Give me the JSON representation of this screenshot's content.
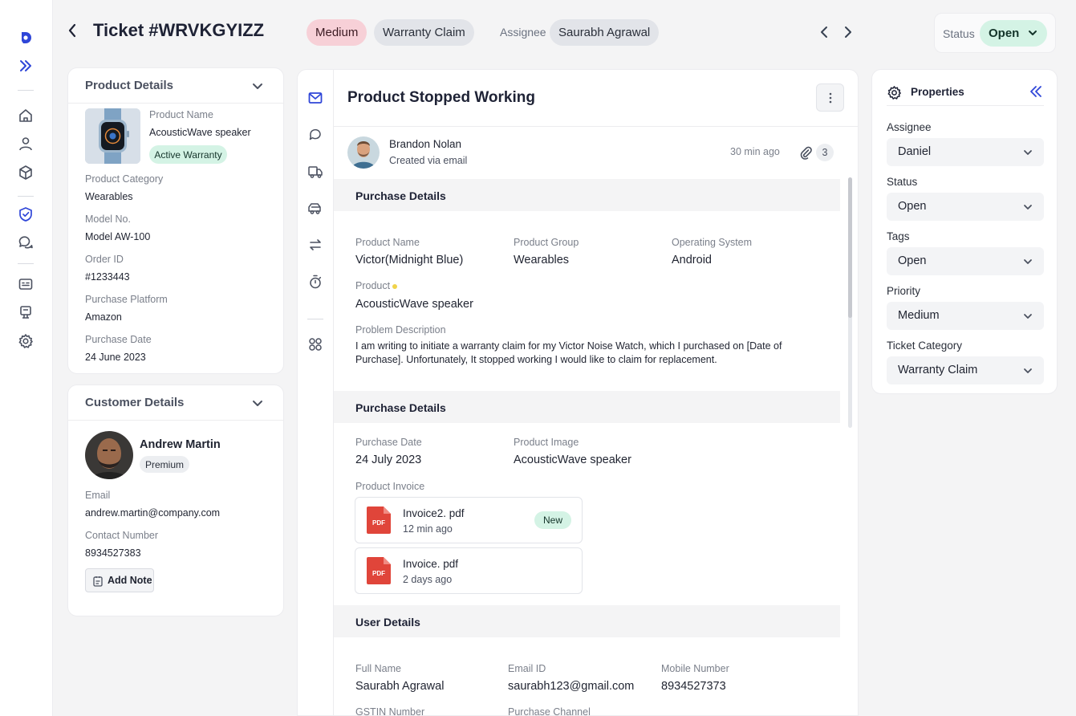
{
  "sidebar": {
    "icons": [
      "logo-icon",
      "expand-icon",
      "home-icon",
      "user-icon",
      "box-icon",
      "shield-check-icon",
      "chat-icon",
      "ticket-list-icon",
      "kiosk-icon",
      "settings-icon"
    ]
  },
  "header": {
    "title": "Ticket #WRVKGYIZZ",
    "priority": "Medium",
    "category": "Warranty Claim",
    "assignee_label": "Assignee",
    "assignee": "Saurabh Agrawal",
    "status_label": "Status",
    "status": "Open"
  },
  "product_details": {
    "title": "Product Details",
    "product_name_label": "Product Name",
    "product_name": "AcousticWave speaker",
    "warranty_badge": "Active Warranty",
    "category_label": "Product Category",
    "category": "Wearables",
    "model_label": "Model No.",
    "model": "Model AW-100",
    "order_label": "Order ID",
    "order": "#1233443",
    "platform_label": "Purchase Platform",
    "platform": "Amazon",
    "date_label": "Purchase Date",
    "date": "24 June 2023"
  },
  "customer_details": {
    "title": "Customer Details",
    "name": "Andrew Martin",
    "tier": "Premium",
    "email_label": "Email",
    "email": "andrew.martin@company.com",
    "contact_label": "Contact Number",
    "contact": "8934527383",
    "add_note": "Add Note"
  },
  "main": {
    "title": "Product Stopped Working",
    "author": "Brandon Nolan",
    "created_via": "Created via email",
    "time": "30 min ago",
    "attachments": "3",
    "purchase1": {
      "heading": "Purchase Details",
      "product_name_label": "Product  Name",
      "product_name": "Victor(Midnight Blue)",
      "group_label": "Product Group",
      "group": "Wearables",
      "os_label": "Operating System",
      "os": "Android",
      "product_label": "Product",
      "product": "AcousticWave speaker",
      "problem_label": "Problem Description",
      "problem_line1": "I am writing to initiate a warranty claim for my Victor Noise Watch, which I purchased on [Date of",
      "problem_line2": "Purchase]. Unfortunately, It stopped working I would like to claim for replacement."
    },
    "purchase2": {
      "heading": "Purchase Details",
      "date_label": "Purchase Date",
      "date": "24 July 2023",
      "image_label": "Product Image",
      "image": "AcousticWave speaker",
      "invoice_label": "Product Invoice",
      "files": [
        {
          "name": "Invoice2. pdf",
          "time": "12 min ago",
          "badge": "New",
          "icon": "PDF"
        },
        {
          "name": "Invoice. pdf",
          "time": "2 days ago",
          "icon": "PDF"
        }
      ]
    },
    "user": {
      "heading": "User Details",
      "fullname_label": "Full Name",
      "fullname": "Saurabh Agrawal",
      "email_label": "Email ID",
      "email": "saurabh123@gmail.com",
      "mobile_label": "Mobile Number",
      "mobile": "8934527373",
      "gstin_label": "GSTIN Number",
      "channel_label": "Purchase Channel"
    }
  },
  "properties": {
    "title": "Properties",
    "assignee_label": "Assignee",
    "assignee": "Daniel",
    "status_label": "Status",
    "status": "Open",
    "tags_label": "Tags",
    "tags": "Open",
    "priority_label": "Priority",
    "priority": "Medium",
    "category_label": "Ticket Category",
    "category": "Warranty Claim"
  },
  "colors": {
    "accent": "#2f46d8",
    "priority_bg": "#f7d0d7",
    "status_bg": "#d4f3e5",
    "pdf_red": "#e0453a"
  }
}
